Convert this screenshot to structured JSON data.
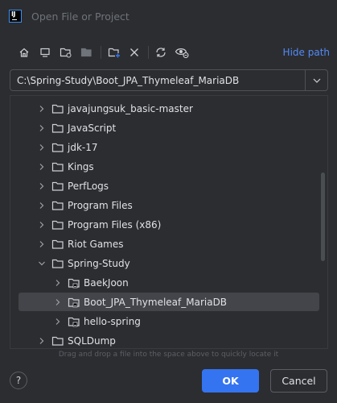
{
  "window": {
    "title": "Open File or Project",
    "logo_icon": "intellij-logo-icon",
    "logo_text": "IJ"
  },
  "toolbar": {
    "icons": [
      "home-icon",
      "desktop-icon",
      "project-folder-icon",
      "module-folder-icon",
      "new-folder-icon",
      "delete-icon",
      "refresh-icon",
      "show-hidden-icon"
    ],
    "hide_path_label": "Hide path"
  },
  "path": {
    "value": "C:\\Spring-Study\\Boot_JPA_Thymeleaf_MariaDB"
  },
  "tree": {
    "items": [
      {
        "label": "javajungsuk_basic-master",
        "expanded": false,
        "level": 1
      },
      {
        "label": "JavaScript",
        "expanded": false,
        "level": 1
      },
      {
        "label": "jdk-17",
        "expanded": false,
        "level": 1
      },
      {
        "label": "Kings",
        "expanded": false,
        "level": 1
      },
      {
        "label": "PerfLogs",
        "expanded": false,
        "level": 1
      },
      {
        "label": "Program Files",
        "expanded": false,
        "level": 1
      },
      {
        "label": "Program Files (x86)",
        "expanded": false,
        "level": 1
      },
      {
        "label": "Riot Games",
        "expanded": false,
        "level": 1
      },
      {
        "label": "Spring-Study",
        "expanded": true,
        "level": 1
      },
      {
        "label": "BaekJoon",
        "expanded": false,
        "level": 2
      },
      {
        "label": "Boot_JPA_Thymeleaf_MariaDB",
        "expanded": false,
        "level": 2,
        "selected": true
      },
      {
        "label": "hello-spring",
        "expanded": false,
        "level": 2
      },
      {
        "label": "SQLDump",
        "expanded": false,
        "level": 1
      }
    ]
  },
  "hint": "Drag and drop a file into the space above to quickly locate it",
  "buttons": {
    "help": "?",
    "ok": "OK",
    "cancel": "Cancel"
  },
  "colors": {
    "background": "#2b2d30",
    "accent": "#3574f0",
    "link": "#548af7",
    "selection": "#43454a"
  }
}
